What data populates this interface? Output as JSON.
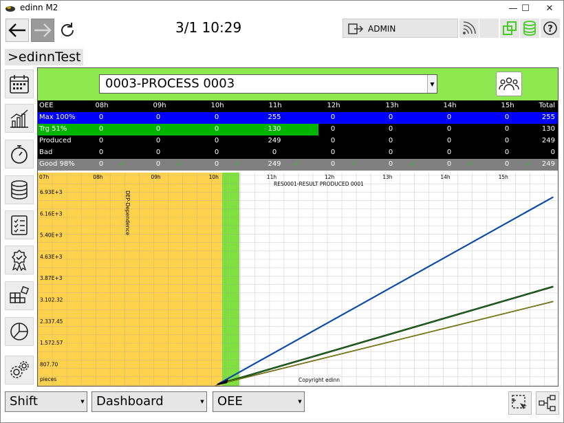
{
  "window": {
    "title": "edinn M2"
  },
  "clock": "3/1 10:29",
  "user": {
    "name": "ADMIN"
  },
  "breadcrumb": ">edinnTest",
  "process": {
    "selected": "0003-PROCESS 0003"
  },
  "table": {
    "headers": [
      "OEE",
      "08h",
      "09h",
      "10h",
      "11h",
      "12h",
      "13h",
      "14h",
      "15h",
      "Total"
    ],
    "rows": [
      {
        "label": "Max 100%",
        "values": [
          "0",
          "0",
          "0",
          "255",
          "0",
          "0",
          "0",
          "0",
          "255"
        ],
        "bg": "#0000ff"
      },
      {
        "label": "Trg 51%",
        "values": [
          "0",
          "0",
          "0",
          "130",
          "0",
          "0",
          "0",
          "0",
          "130"
        ],
        "bg": "#000000",
        "hl": "#00b400"
      },
      {
        "label": "Produced",
        "values": [
          "0",
          "0",
          "0",
          "249",
          "0",
          "0",
          "0",
          "0",
          "249"
        ],
        "bg": "#000000"
      },
      {
        "label": "Bad",
        "values": [
          "0",
          "0",
          "0",
          "0",
          "0",
          "0",
          "0",
          "0",
          "0"
        ],
        "bg": "#000000"
      },
      {
        "label": "Good 98%",
        "values": [
          "0",
          "0",
          "0",
          "249",
          "0",
          "0",
          "0",
          "0",
          "249"
        ],
        "bg": "#808080"
      }
    ],
    "check_glyph": "✓"
  },
  "chart_data": {
    "type": "line",
    "x_ticks": [
      "07h",
      "08h",
      "09h",
      "10h",
      "11h",
      "12h",
      "13h",
      "14h",
      "15h"
    ],
    "y_ticks": [
      "6.93E+3",
      "6.16E+3",
      "5.40E+3",
      "4.63E+3",
      "3.87E+3",
      "3.102.32",
      "2.337.45",
      "1.572.57",
      "807.70"
    ],
    "y_unit": "pieces",
    "annotations": [
      "DEP-Dependence",
      "RES0001-RESULT PRODUCED 0001"
    ],
    "footer": "Copyright edinn",
    "series": [
      {
        "color": "#0a4aa6",
        "x": [
          10.1,
          15.9
        ],
        "y": [
          0,
          6550
        ]
      },
      {
        "color": "#1a8a1a",
        "x": [
          10.1,
          15.9
        ],
        "y": [
          0,
          3420
        ]
      },
      {
        "color": "#8a8a00",
        "x": [
          10.1,
          15.9
        ],
        "y": [
          0,
          2900
        ]
      }
    ],
    "colors": {
      "yellow_zone": "#ffd24d",
      "green_zone": "#7fe040"
    }
  },
  "bottom": {
    "shift": "Shift",
    "view": "Dashboard",
    "metric": "OEE"
  },
  "colors": {
    "accent_green": "#8ee84f",
    "icon_green": "#44cc22"
  }
}
